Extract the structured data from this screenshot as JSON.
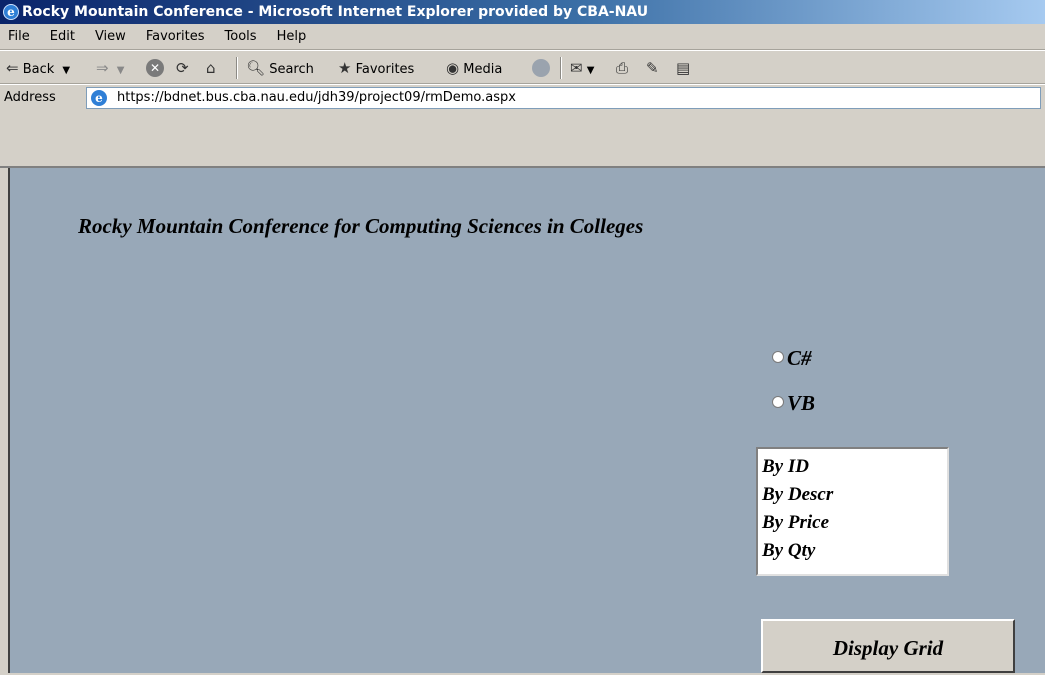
{
  "window": {
    "title": "Rocky Mountain Conference - Microsoft Internet Explorer provided by CBA-NAU"
  },
  "menu": {
    "items": [
      "File",
      "Edit",
      "View",
      "Favorites",
      "Tools",
      "Help"
    ]
  },
  "toolbar": {
    "back_label": "Back",
    "search_label": "Search",
    "favorites_label": "Favorites",
    "media_label": "Media"
  },
  "address": {
    "label": "Address",
    "url": "https://bdnet.bus.cba.nau.edu/jdh39/project09/rmDemo.aspx"
  },
  "page": {
    "heading": "Rocky Mountain Conference for Computing Sciences in Colleges",
    "radios": [
      {
        "label": "C#",
        "checked": false
      },
      {
        "label": "VB",
        "checked": false
      }
    ],
    "listbox_items": [
      "By ID",
      "By Descr",
      "By Price",
      "By Qty"
    ],
    "button_label": "Display Grid"
  },
  "colors": {
    "titlebar": "#0a246a",
    "chrome": "#d4d0c8",
    "content_background": "#98a8b8"
  }
}
